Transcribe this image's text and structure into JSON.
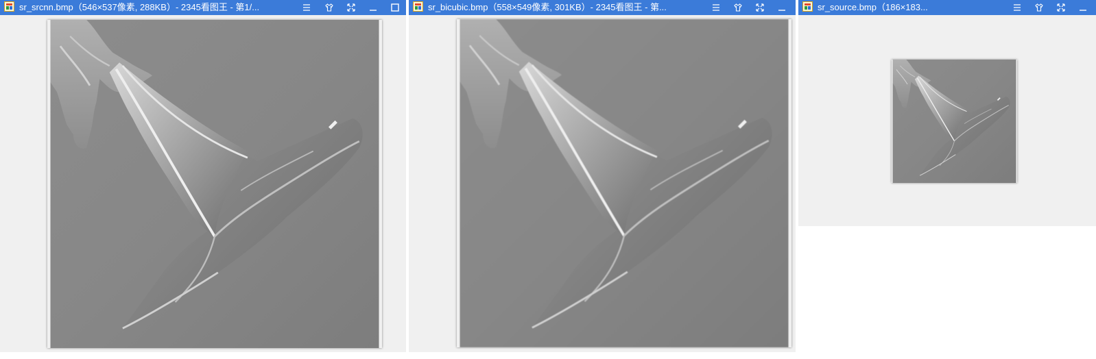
{
  "windows": [
    {
      "title": "sr_srcnn.bmp（546×537像素, 288KB）- 2345看图王 - 第1/...",
      "controls": [
        "menu",
        "skin",
        "fullscreen",
        "minimize",
        "maximize"
      ]
    },
    {
      "title": "sr_bicubic.bmp（558×549像素, 301KB）- 2345看图王 - 第...",
      "controls": [
        "menu",
        "skin",
        "fullscreen",
        "minimize"
      ]
    },
    {
      "title": "sr_source.bmp（186×183...",
      "controls": [
        "menu",
        "skin",
        "fullscreen",
        "minimize"
      ]
    }
  ],
  "colors": {
    "titlebar": "#3b7bd9",
    "viewer_bg": "#f0f0f0",
    "photo_bg": "#8a8a8a"
  }
}
